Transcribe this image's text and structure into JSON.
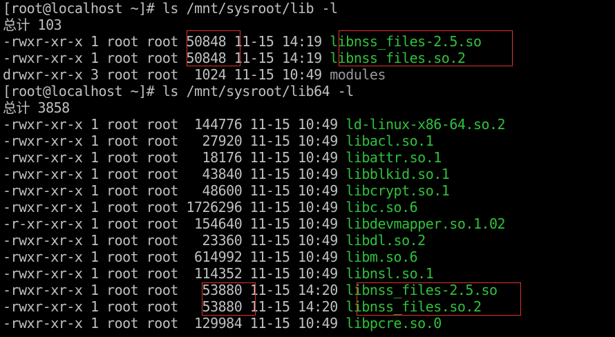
{
  "colors": {
    "background": "#000000",
    "text": "#c0c0c0",
    "exec_file": "#2fc23a",
    "directory": "#9a9a9a",
    "highlight_box": "#e0342f"
  },
  "lines": [
    {
      "type": "prompt",
      "text": "[root@localhost ~]# ls /mnt/sysroot/lib -l"
    },
    {
      "type": "total",
      "text": "总计 103"
    },
    {
      "type": "entry",
      "prefix": "-rwxr-xr-x 1 root root ",
      "size": "50848",
      "middle": " 11-15 14:19 ",
      "name": "libnss_files-2.5.so",
      "kind": "exec"
    },
    {
      "type": "entry",
      "prefix": "-rwxr-xr-x 1 root root ",
      "size": "50848",
      "middle": " 11-15 14:19 ",
      "name": "libnss_files.so.2",
      "kind": "exec"
    },
    {
      "type": "entry",
      "prefix": "drwxr-xr-x 3 root root  ",
      "size": "1024",
      "middle": " 11-15 10:49 ",
      "name": "modules",
      "kind": "dir"
    },
    {
      "type": "prompt",
      "text": "[root@localhost ~]# ls /mnt/sysroot/lib64 -l"
    },
    {
      "type": "total",
      "text": "总计 3858"
    },
    {
      "type": "entry",
      "prefix": "-rwxr-xr-x 1 root root  ",
      "size": "144776",
      "middle": " 11-15 10:49 ",
      "name": "ld-linux-x86-64.so.2",
      "kind": "exec"
    },
    {
      "type": "entry",
      "prefix": "-rwxr-xr-x 1 root root   ",
      "size": "27920",
      "middle": " 11-15 10:49 ",
      "name": "libacl.so.1",
      "kind": "exec"
    },
    {
      "type": "entry",
      "prefix": "-rwxr-xr-x 1 root root   ",
      "size": "18176",
      "middle": " 11-15 10:49 ",
      "name": "libattr.so.1",
      "kind": "exec"
    },
    {
      "type": "entry",
      "prefix": "-rwxr-xr-x 1 root root   ",
      "size": "43840",
      "middle": " 11-15 10:49 ",
      "name": "libblkid.so.1",
      "kind": "exec"
    },
    {
      "type": "entry",
      "prefix": "-rwxr-xr-x 1 root root   ",
      "size": "48600",
      "middle": " 11-15 10:49 ",
      "name": "libcrypt.so.1",
      "kind": "exec"
    },
    {
      "type": "entry",
      "prefix": "-rwxr-xr-x 1 root root ",
      "size": "1726296",
      "middle": " 11-15 10:49 ",
      "name": "libc.so.6",
      "kind": "exec"
    },
    {
      "type": "entry",
      "prefix": "-r-xr-xr-x 1 root root  ",
      "size": "154640",
      "middle": " 11-15 10:49 ",
      "name": "libdevmapper.so.1.02",
      "kind": "exec"
    },
    {
      "type": "entry",
      "prefix": "-rwxr-xr-x 1 root root   ",
      "size": "23360",
      "middle": " 11-15 10:49 ",
      "name": "libdl.so.2",
      "kind": "exec"
    },
    {
      "type": "entry",
      "prefix": "-rwxr-xr-x 1 root root  ",
      "size": "614992",
      "middle": " 11-15 10:49 ",
      "name": "libm.so.6",
      "kind": "exec"
    },
    {
      "type": "entry",
      "prefix": "-rwxr-xr-x 1 root root  ",
      "size": "114352",
      "middle": " 11-15 10:49 ",
      "name": "libnsl.so.1",
      "kind": "exec"
    },
    {
      "type": "entry",
      "prefix": "-rwxr-xr-x 1 root root   ",
      "size": "53880",
      "middle": " 11-15 14:20 ",
      "name": "libnss_files-2.5.so",
      "kind": "exec"
    },
    {
      "type": "entry",
      "prefix": "-rwxr-xr-x 1 root root   ",
      "size": "53880",
      "middle": " 11-15 14:20 ",
      "name": "libnss_files.so.2",
      "kind": "exec"
    },
    {
      "type": "entry",
      "prefix": "-rwxr-xr-x 1 root root  ",
      "size": "129984",
      "middle": " 11-15 10:49 ",
      "name": "libpcre.so.0",
      "kind": "exec"
    }
  ]
}
